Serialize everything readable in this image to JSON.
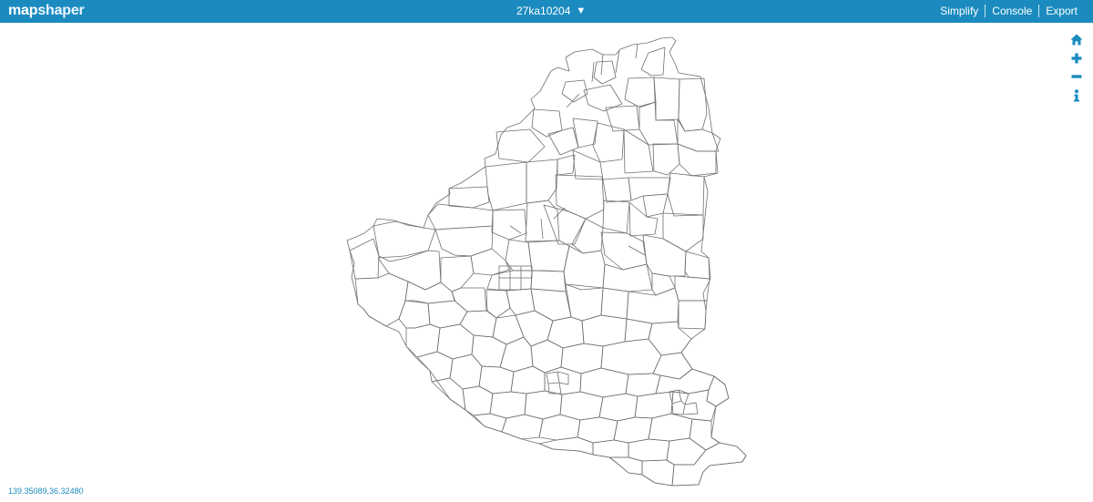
{
  "app": {
    "logo_part1": "map",
    "logo_part2": "shaper"
  },
  "layer": {
    "name": "27ka10204",
    "dropdown_icon": "triangle-down-icon"
  },
  "menu": {
    "simplify": "Simplify",
    "console": "Console",
    "export": "Export"
  },
  "tools": [
    {
      "name": "home-icon"
    },
    {
      "name": "zoom-in-icon"
    },
    {
      "name": "zoom-out-icon"
    },
    {
      "name": "info-icon"
    }
  ],
  "status": {
    "coordinates": "139.35089,36.32480"
  },
  "colors": {
    "accent": "#1b8bbf",
    "map_stroke": "#6f6f6f"
  }
}
